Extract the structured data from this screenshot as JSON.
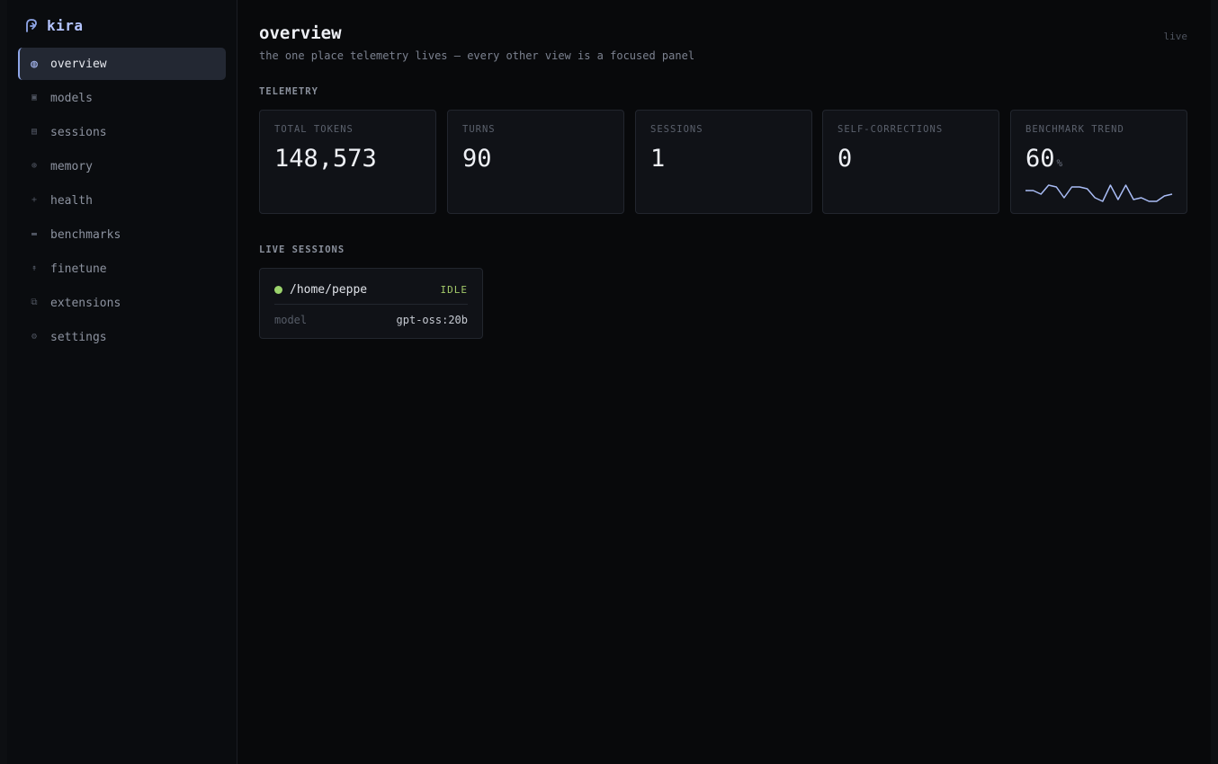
{
  "app": {
    "name": "kira",
    "accent": "#b4c4ff"
  },
  "sidebar": {
    "items": [
      {
        "label": "overview",
        "icon": "globe-icon",
        "active": true
      },
      {
        "label": "models",
        "icon": "square-icon"
      },
      {
        "label": "sessions",
        "icon": "list-icon"
      },
      {
        "label": "memory",
        "icon": "target-icon"
      },
      {
        "label": "health",
        "icon": "plus-icon"
      },
      {
        "label": "benchmarks",
        "icon": "bar-icon"
      },
      {
        "label": "finetune",
        "icon": "pin-icon"
      },
      {
        "label": "extensions",
        "icon": "stack-icon"
      },
      {
        "label": "settings",
        "icon": "gear-icon"
      }
    ]
  },
  "header": {
    "title": "overview",
    "subtitle": "the one place telemetry lives — every other view is a focused panel",
    "status": "live"
  },
  "telemetry": {
    "label": "TELEMETRY",
    "cards": [
      {
        "label": "TOTAL TOKENS",
        "value": "148,573"
      },
      {
        "label": "TURNS",
        "value": "90"
      },
      {
        "label": "SESSIONS",
        "value": "1"
      },
      {
        "label": "SELF-CORRECTIONS",
        "value": "0"
      },
      {
        "label": "BENCHMARK TREND",
        "value": "60",
        "unit": "%"
      }
    ],
    "trend": {
      "color": "#a9bcf5",
      "values": [
        60,
        60,
        58,
        63,
        62,
        56,
        62,
        62,
        61,
        56,
        54,
        63,
        55,
        63,
        55,
        56,
        54,
        54,
        57,
        58
      ]
    }
  },
  "live_sessions": {
    "label": "LIVE SESSIONS",
    "items": [
      {
        "path": "/home/peppe",
        "status": "IDLE",
        "model_key": "model",
        "model_value": "gpt-oss:20b",
        "status_color": "#9bd36c"
      }
    ]
  }
}
